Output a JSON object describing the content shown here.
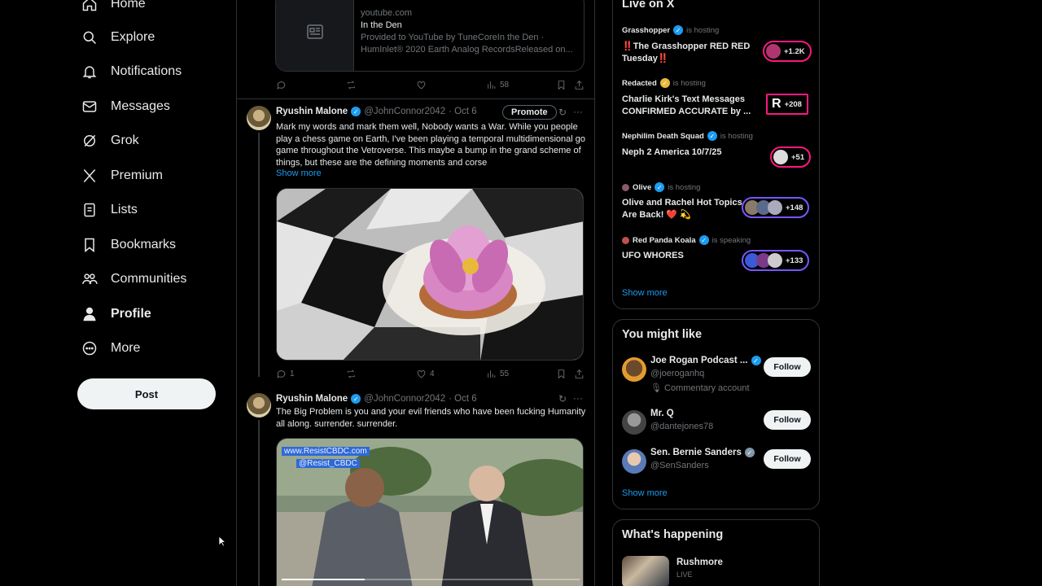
{
  "nav": {
    "items": [
      {
        "label": "Home",
        "icon": "home-icon"
      },
      {
        "label": "Explore",
        "icon": "search-icon"
      },
      {
        "label": "Notifications",
        "icon": "bell-icon"
      },
      {
        "label": "Messages",
        "icon": "mail-icon"
      },
      {
        "label": "Grok",
        "icon": "grok-icon"
      },
      {
        "label": "Premium",
        "icon": "x-logo-icon"
      },
      {
        "label": "Lists",
        "icon": "list-icon"
      },
      {
        "label": "Bookmarks",
        "icon": "bookmark-icon"
      },
      {
        "label": "Communities",
        "icon": "people-icon"
      },
      {
        "label": "Profile",
        "icon": "person-icon"
      },
      {
        "label": "More",
        "icon": "more-circle-icon"
      }
    ],
    "post_label": "Post"
  },
  "feed": {
    "link_card": {
      "domain": "youtube.com",
      "title": "In the Den",
      "desc1": "Provided to YouTube by TuneCoreIn the Den ·",
      "desc2": "HumInlet® 2020 Earth Analog RecordsReleased on..."
    },
    "card_actions": {
      "views": "58"
    },
    "tweet1": {
      "name": "Ryushin Malone",
      "handle": "@JohnConnor2042",
      "date": "· Oct 6",
      "promote": "Promote",
      "text": "Mark my words and mark them well, Nobody wants a War. While you people play a chess game on Earth, I've been playing a temporal multidimensional go game throughout the Vetroverse. This maybe a bump in the grand scheme of things, but these are the defining moments and corse",
      "show_more": "Show more",
      "replies": "1",
      "likes": "4",
      "views": "55"
    },
    "tweet2": {
      "name": "Ryushin Malone",
      "handle": "@JohnConnor2042",
      "date": "· Oct 6",
      "text": "The Big Problem is you and your evil friends who have been fucking Humanity all along. surrender. surrender.",
      "watermark1": "www.ResistCBDC.com",
      "watermark2": "@Resist_CBDC"
    }
  },
  "live": {
    "title": "Live on X",
    "spaces": [
      {
        "host": "Grasshopper",
        "status": "is hosting",
        "title": "‼️The Grasshopper RED RED Tuesday‼️",
        "count": "+1.2K"
      },
      {
        "host": "Redacted",
        "status": "is hosting",
        "title": "Charlie Kirk's Text Messages CONFIRMED ACCURATE by ...",
        "count": "+208"
      },
      {
        "host": "Nephilim Death Squad",
        "status": "is hosting",
        "title": "Neph 2 America 10/7/25",
        "count": "+51"
      },
      {
        "host": "Olive",
        "status": "is hosting",
        "title": "Olive and Rachel Hot Topics Are Back! ❤️ 💫",
        "count": "+148"
      },
      {
        "host": "Red Panda Koala",
        "status": "is speaking",
        "title": "UFO WHORES",
        "count": "+133"
      }
    ],
    "show_more": "Show more"
  },
  "suggest": {
    "title": "You might like",
    "users": [
      {
        "name": "Joe Rogan Podcast ...",
        "handle": "@joeroganhq",
        "note": "Commentary account",
        "follow": "Follow"
      },
      {
        "name": "Mr. Q",
        "handle": "@dantejones78",
        "follow": "Follow"
      },
      {
        "name": "Sen. Bernie Sanders",
        "handle": "@SenSanders",
        "follow": "Follow"
      }
    ],
    "show_more": "Show more"
  },
  "happening": {
    "title": "What's happening",
    "item": {
      "name": "Rushmore",
      "status": "LIVE"
    }
  }
}
